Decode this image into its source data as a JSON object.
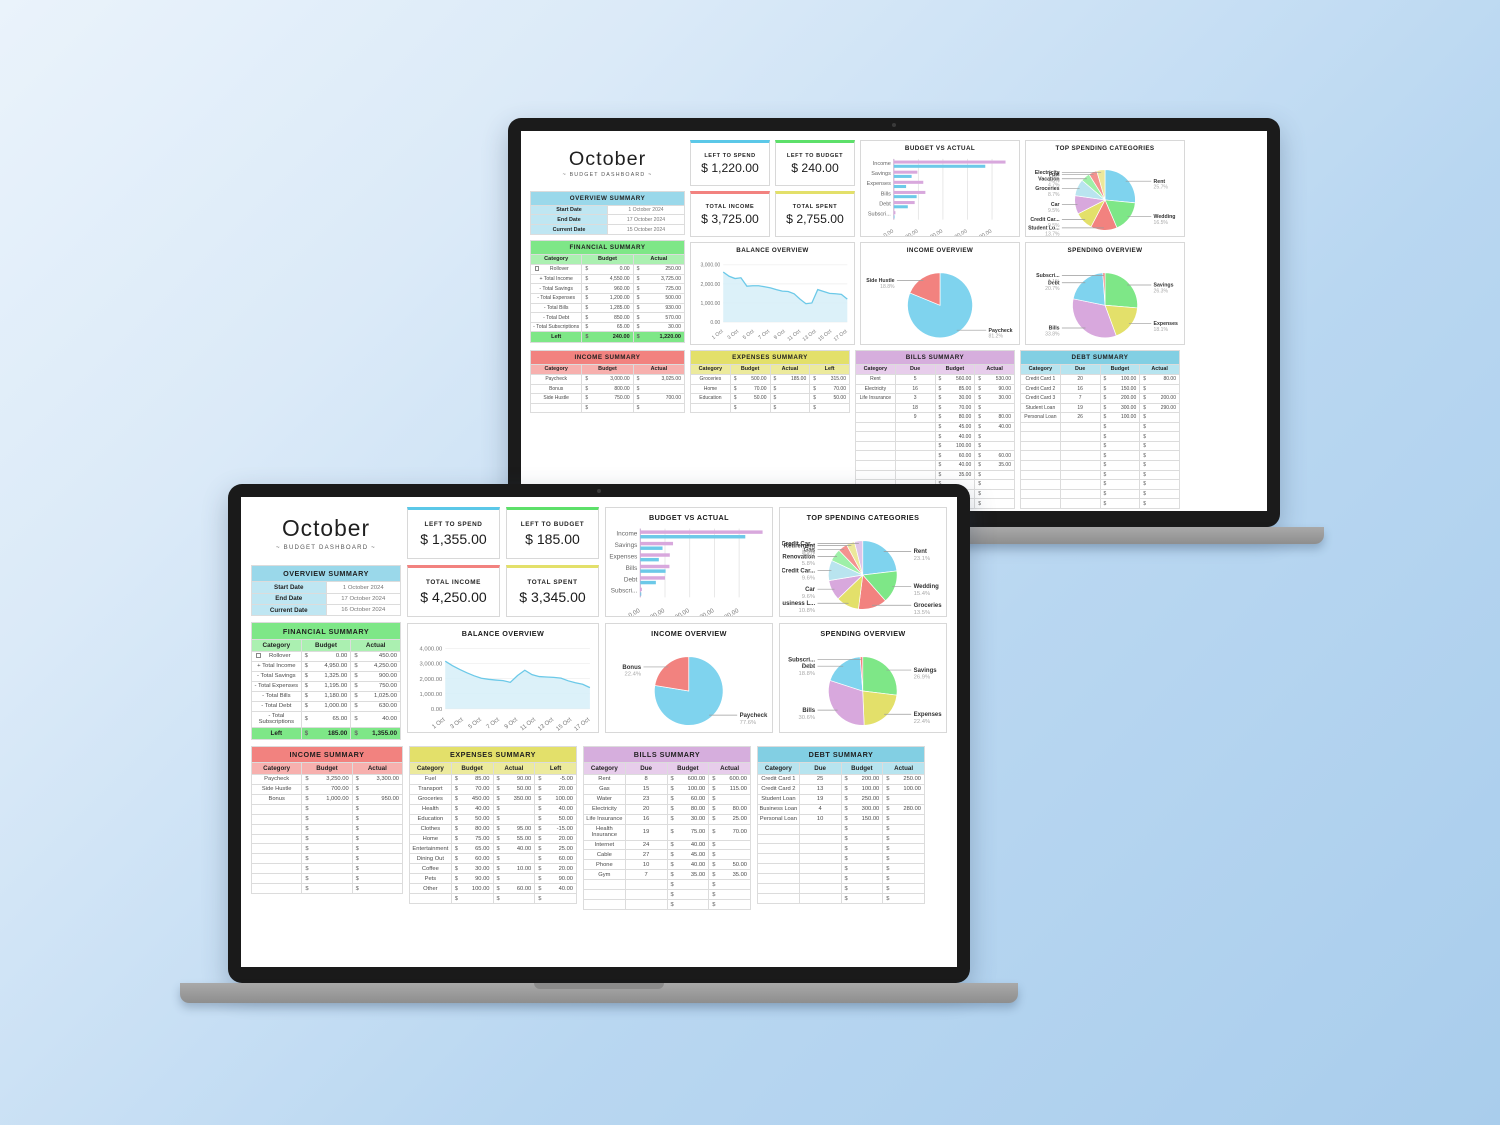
{
  "meta": {
    "background_gradient_from": "#eaf3fb",
    "background_gradient_to": "#a9cdec",
    "laptop_frame_color": "#1a1a1a",
    "laptop_base_color": "#9a9a9a"
  },
  "front": {
    "title": {
      "month": "October",
      "subtitle": "~ BUDGET DASHBOARD ~"
    },
    "kpis": [
      {
        "label": "LEFT TO SPEND",
        "value": "$ 1,355.00",
        "accent": "#5bc8e8"
      },
      {
        "label": "LEFT TO BUDGET",
        "value": "$ 185.00",
        "accent": "#5de06a"
      },
      {
        "label": "TOTAL INCOME",
        "value": "$ 4,250.00",
        "accent": "#f2827f"
      },
      {
        "label": "TOTAL SPENT",
        "value": "$ 3,345.00",
        "accent": "#e3e06a"
      }
    ],
    "overview_summary": {
      "title": "OVERVIEW SUMMARY",
      "rows": [
        {
          "label": "Start Date",
          "value": "1 October 2024"
        },
        {
          "label": "End Date",
          "value": "17 October 2024"
        },
        {
          "label": "Current Date",
          "value": "16 October 2024"
        }
      ]
    },
    "financial_summary": {
      "title": "FINANCIAL SUMMARY",
      "headers": [
        "Category",
        "Budget",
        "Actual"
      ],
      "rows": [
        {
          "label": "Rollover",
          "budget": "0.00",
          "actual": "450.00",
          "checkbox": true
        },
        {
          "label": "+ Total Income",
          "budget": "4,950.00",
          "actual": "4,250.00"
        },
        {
          "label": "- Total Savings",
          "budget": "1,325.00",
          "actual": "900.00"
        },
        {
          "label": "- Total Expenses",
          "budget": "1,195.00",
          "actual": "750.00"
        },
        {
          "label": "- Total Bills",
          "budget": "1,180.00",
          "actual": "1,025.00"
        },
        {
          "label": "- Total Debt",
          "budget": "1,000.00",
          "actual": "630.00"
        },
        {
          "label": "- Total Subscriptions",
          "budget": "65.00",
          "actual": "40.00"
        }
      ],
      "total": {
        "label": "Left",
        "budget": "185.00",
        "actual": "1,355.00"
      }
    },
    "income_summary": {
      "title": "INCOME SUMMARY",
      "headers": [
        "Category",
        "Budget",
        "Actual"
      ],
      "rows": [
        {
          "c": "Paycheck",
          "b": "3,250.00",
          "a": "3,300.00"
        },
        {
          "c": "Side Hustle",
          "b": "700.00",
          "a": ""
        },
        {
          "c": "Bonus",
          "b": "1,000.00",
          "a": "950.00"
        }
      ],
      "blank_rows": 9
    },
    "expenses_summary": {
      "title": "EXPENSES SUMMARY",
      "headers": [
        "Category",
        "Budget",
        "Actual",
        "Left"
      ],
      "rows": [
        {
          "c": "Fuel",
          "b": "85.00",
          "a": "90.00",
          "l": "-5.00"
        },
        {
          "c": "Transport",
          "b": "70.00",
          "a": "50.00",
          "l": "20.00"
        },
        {
          "c": "Groceries",
          "b": "450.00",
          "a": "350.00",
          "l": "100.00"
        },
        {
          "c": "Health",
          "b": "40.00",
          "a": "",
          "l": "40.00"
        },
        {
          "c": "Education",
          "b": "50.00",
          "a": "",
          "l": "50.00"
        },
        {
          "c": "Clothes",
          "b": "80.00",
          "a": "95.00",
          "l": "-15.00"
        },
        {
          "c": "Home",
          "b": "75.00",
          "a": "55.00",
          "l": "20.00"
        },
        {
          "c": "Entertainment",
          "b": "65.00",
          "a": "40.00",
          "l": "25.00"
        },
        {
          "c": "Dining Out",
          "b": "60.00",
          "a": "",
          "l": "60.00"
        },
        {
          "c": "Coffee",
          "b": "30.00",
          "a": "10.00",
          "l": "20.00"
        },
        {
          "c": "Pets",
          "b": "90.00",
          "a": "",
          "l": "90.00"
        },
        {
          "c": "Other",
          "b": "100.00",
          "a": "60.00",
          "l": "40.00"
        }
      ],
      "blank_rows": 1
    },
    "bills_summary": {
      "title": "BILLS SUMMARY",
      "headers": [
        "Category",
        "Due",
        "Budget",
        "Actual"
      ],
      "rows": [
        {
          "c": "Rent",
          "d": "8",
          "b": "600.00",
          "a": "600.00"
        },
        {
          "c": "Gas",
          "d": "15",
          "b": "100.00",
          "a": "115.00"
        },
        {
          "c": "Water",
          "d": "23",
          "b": "60.00",
          "a": ""
        },
        {
          "c": "Electricity",
          "d": "20",
          "b": "80.00",
          "a": "80.00"
        },
        {
          "c": "Life Insurance",
          "d": "16",
          "b": "30.00",
          "a": "25.00"
        },
        {
          "c": "Health Insurance",
          "d": "19",
          "b": "75.00",
          "a": "70.00"
        },
        {
          "c": "Internet",
          "d": "24",
          "b": "40.00",
          "a": ""
        },
        {
          "c": "Cable",
          "d": "27",
          "b": "45.00",
          "a": ""
        },
        {
          "c": "Phone",
          "d": "10",
          "b": "40.00",
          "a": "50.00"
        },
        {
          "c": "Gym",
          "d": "7",
          "b": "35.00",
          "a": "35.00"
        }
      ],
      "blank_rows": 3
    },
    "debt_summary": {
      "title": "DEBT SUMMARY",
      "headers": [
        "Category",
        "Due",
        "Budget",
        "Actual"
      ],
      "rows": [
        {
          "c": "Credit Card 1",
          "d": "25",
          "b": "200.00",
          "a": "250.00"
        },
        {
          "c": "Credit Card 2",
          "d": "13",
          "b": "100.00",
          "a": "100.00"
        },
        {
          "c": "Student Loan",
          "d": "19",
          "b": "250.00",
          "a": ""
        },
        {
          "c": "Business Loan",
          "d": "4",
          "b": "300.00",
          "a": "280.00"
        },
        {
          "c": "Personal Loan",
          "d": "10",
          "b": "150.00",
          "a": ""
        }
      ],
      "blank_rows": 8
    },
    "chart_data": [
      {
        "type": "bar",
        "title": "BUDGET VS ACTUAL",
        "orientation": "horizontal",
        "categories": [
          "Income",
          "Savings",
          "Expenses",
          "Bills",
          "Debt",
          "Subscri..."
        ],
        "series": [
          {
            "name": "Budget",
            "color": "#d8a8dd",
            "values": [
              4950,
              1325,
              1195,
              1180,
              1000,
              65
            ]
          },
          {
            "name": "Actual",
            "color": "#6cc9e8",
            "values": [
              4250,
              900,
              750,
              1025,
              630,
              40
            ]
          }
        ],
        "xlim": [
          0,
          5000
        ],
        "xticks": [
          "0.00",
          "1,000.00",
          "2,000.00",
          "3,000.00",
          "4,000.00"
        ],
        "grid": true
      },
      {
        "type": "pie",
        "title": "TOP SPENDING CATEGORIES",
        "labels": [
          "Rent",
          "Wedding",
          "Groceries",
          "Business L...",
          "Car",
          "Credit Car...",
          "Renovation",
          "Gas",
          "Retirement",
          "Credit Car..."
        ],
        "percents": [
          23.1,
          15.4,
          13.5,
          10.8,
          9.6,
          9.6,
          5.8,
          4.4,
          3.9,
          3.9
        ],
        "colors": [
          "#7fd3ee",
          "#7ee787",
          "#f2827f",
          "#e3e06a",
          "#d8a8dd",
          "#b9e4ef",
          "#9ef0a8",
          "#f4928f",
          "#ece89a",
          "#e0c4e8"
        ]
      },
      {
        "type": "area",
        "title": "BALANCE OVERVIEW",
        "line_color": "#6cc9e8",
        "fill_color": "#d6eef8",
        "ylim": [
          0,
          4000
        ],
        "yticks": [
          "0.00",
          "1,000.00",
          "2,000.00",
          "3,000.00",
          "4,000.00"
        ],
        "xticks": [
          "1 Oct",
          "3 Oct",
          "5 Oct",
          "7 Oct",
          "9 Oct",
          "11 Oct",
          "13 Oct",
          "15 Oct",
          "17 Oct"
        ],
        "values": [
          3150,
          2850,
          2600,
          2380,
          2180,
          2020,
          1950,
          1900,
          1860,
          1750,
          2200,
          2550,
          2260,
          2130,
          2100,
          2080,
          2030,
          1850,
          1720,
          1620,
          1400
        ]
      },
      {
        "type": "pie",
        "title": "INCOME OVERVIEW",
        "labels": [
          "Paycheck",
          "Bonus"
        ],
        "percents": [
          77.6,
          22.4
        ],
        "colors": [
          "#7fd3ee",
          "#f2827f"
        ]
      },
      {
        "type": "pie",
        "title": "SPENDING OVERVIEW",
        "labels": [
          "Savings",
          "Expenses",
          "Bills",
          "Debt",
          "Subscri..."
        ],
        "percents": [
          26.9,
          22.4,
          30.6,
          18.8,
          1.2
        ],
        "colors": [
          "#7ee787",
          "#e3e06a",
          "#d8a8dd",
          "#7fd3ee",
          "#f2827f"
        ]
      }
    ]
  },
  "back": {
    "title": {
      "month": "October",
      "subtitle": "~ BUDGET DASHBOARD ~"
    },
    "kpis": [
      {
        "label": "LEFT TO SPEND",
        "value": "$ 1,220.00",
        "accent": "#5bc8e8"
      },
      {
        "label": "LEFT TO BUDGET",
        "value": "$ 240.00",
        "accent": "#5de06a"
      },
      {
        "label": "TOTAL INCOME",
        "value": "$ 3,725.00",
        "accent": "#f2827f"
      },
      {
        "label": "TOTAL SPENT",
        "value": "$ 2,755.00",
        "accent": "#e3e06a"
      }
    ],
    "overview_summary": {
      "title": "OVERVIEW SUMMARY",
      "rows": [
        {
          "label": "Start Date",
          "value": "1 October 2024"
        },
        {
          "label": "End Date",
          "value": "17 October 2024"
        },
        {
          "label": "Current Date",
          "value": "15 October 2024"
        }
      ]
    },
    "financial_summary": {
      "title": "FINANCIAL SUMMARY",
      "headers": [
        "Category",
        "Budget",
        "Actual"
      ],
      "rows": [
        {
          "label": "Rollover",
          "budget": "0.00",
          "actual": "250.00",
          "checkbox": true
        },
        {
          "label": "+ Total Income",
          "budget": "4,550.00",
          "actual": "3,725.00"
        },
        {
          "label": "- Total Savings",
          "budget": "960.00",
          "actual": "725.00"
        },
        {
          "label": "- Total Expenses",
          "budget": "1,200.00",
          "actual": "500.00"
        },
        {
          "label": "- Total Bills",
          "budget": "1,285.00",
          "actual": "930.00"
        },
        {
          "label": "- Total Debt",
          "budget": "850.00",
          "actual": "570.00"
        },
        {
          "label": "- Total Subscriptions",
          "budget": "65.00",
          "actual": "30.00"
        }
      ],
      "total": {
        "label": "Left",
        "budget": "240.00",
        "actual": "1,220.00"
      }
    },
    "income_summary": {
      "title": "INCOME SUMMARY",
      "headers": [
        "Category",
        "Budget",
        "Actual"
      ],
      "rows": [
        {
          "c": "Paycheck",
          "b": "3,000.00",
          "a": "3,025.00"
        },
        {
          "c": "Bonus",
          "b": "800.00",
          "a": ""
        },
        {
          "c": "Side Hustle",
          "b": "750.00",
          "a": "700.00"
        }
      ],
      "blank_rows": 1
    },
    "expenses_summary": {
      "title": "EXPENSES SUMMARY",
      "headers": [
        "Category",
        "Budget",
        "Actual",
        "Left"
      ],
      "rows": [
        {
          "c": "Groceries",
          "b": "500.00",
          "a": "185.00",
          "l": "315.00"
        },
        {
          "c": "Home",
          "b": "70.00",
          "a": "",
          "l": "70.00"
        },
        {
          "c": "Education",
          "b": "50.00",
          "a": "",
          "l": "50.00"
        }
      ],
      "blank_rows": 1
    },
    "bills_summary": {
      "title": "BILLS SUMMARY",
      "headers": [
        "Category",
        "Due",
        "Budget",
        "Actual"
      ],
      "rows": [
        {
          "c": "Rent",
          "d": "5",
          "b": "560.00",
          "a": "530.00"
        },
        {
          "c": "Electricity",
          "d": "16",
          "b": "85.00",
          "a": "90.00"
        },
        {
          "c": "Life Insurance",
          "d": "3",
          "b": "30.00",
          "a": "30.00"
        },
        {
          "c": "",
          "d": "18",
          "b": "70.00",
          "a": ""
        },
        {
          "c": "",
          "d": "9",
          "b": "80.00",
          "a": "80.00"
        },
        {
          "c": "",
          "d": "",
          "b": "45.00",
          "a": "40.00"
        },
        {
          "c": "",
          "d": "",
          "b": "40.00",
          "a": ""
        },
        {
          "c": "",
          "d": "",
          "b": "100.00",
          "a": ""
        },
        {
          "c": "",
          "d": "",
          "b": "60.00",
          "a": "60.00"
        },
        {
          "c": "",
          "d": "",
          "b": "40.00",
          "a": "35.00"
        },
        {
          "c": "",
          "d": "",
          "b": "35.00",
          "a": ""
        }
      ],
      "blank_rows": 3
    },
    "debt_summary": {
      "title": "DEBT SUMMARY",
      "headers": [
        "Category",
        "Due",
        "Budget",
        "Actual"
      ],
      "rows": [
        {
          "c": "Credit Card 1",
          "d": "20",
          "b": "100.00",
          "a": "80.00"
        },
        {
          "c": "Credit Card 2",
          "d": "16",
          "b": "150.00",
          "a": ""
        },
        {
          "c": "Credit Card 3",
          "d": "7",
          "b": "200.00",
          "a": "200.00"
        },
        {
          "c": "Student Loan",
          "d": "19",
          "b": "300.00",
          "a": "290.00"
        },
        {
          "c": "Personal Loan",
          "d": "26",
          "b": "100.00",
          "a": ""
        }
      ],
      "blank_rows": 9
    },
    "chart_data": [
      {
        "type": "bar",
        "title": "BUDGET VS ACTUAL",
        "orientation": "horizontal",
        "categories": [
          "Income",
          "Savings",
          "Expenses",
          "Bills",
          "Debt",
          "Subscri..."
        ],
        "series": [
          {
            "name": "Budget",
            "color": "#d8a8dd",
            "values": [
              4550,
              960,
              1200,
              1285,
              850,
              65
            ]
          },
          {
            "name": "Actual",
            "color": "#6cc9e8",
            "values": [
              3725,
              725,
              500,
              930,
              570,
              30
            ]
          }
        ],
        "xlim": [
          0,
          4800
        ],
        "xticks": [
          "0.00",
          "1,000.00",
          "2,000.00",
          "3,000.00",
          "4,000.00"
        ],
        "grid": true
      },
      {
        "type": "pie",
        "title": "TOP SPENDING CATEGORIES",
        "labels": [
          "Rent",
          "Wedding",
          "Student Lo...",
          "Credit Car...",
          "Car",
          "Groceries",
          "Vacation",
          "Fuel",
          "Electricity"
        ],
        "percents": [
          25.7,
          16.5,
          13.7,
          9.5,
          9.5,
          8.7,
          4.7,
          4.3,
          4.3
        ],
        "colors": [
          "#7fd3ee",
          "#7ee787",
          "#f2827f",
          "#e3e06a",
          "#d8a8dd",
          "#b9e4ef",
          "#9ef0a8",
          "#f4928f",
          "#ece89a"
        ]
      },
      {
        "type": "area",
        "title": "BALANCE OVERVIEW",
        "line_color": "#6cc9e8",
        "fill_color": "#d6eef8",
        "ylim": [
          0,
          3000
        ],
        "yticks": [
          "0.00",
          "1,000.00",
          "2,000.00",
          "3,000.00"
        ],
        "xticks": [
          "1 Oct",
          "3 Oct",
          "5 Oct",
          "7 Oct",
          "9 Oct",
          "11 Oct",
          "13 Oct",
          "15 Oct",
          "17 Oct"
        ],
        "values": [
          2620,
          2400,
          2280,
          2320,
          1880,
          1900,
          1900,
          1850,
          1790,
          1700,
          1620,
          1600,
          1480,
          1200,
          960,
          1000,
          1700,
          1600,
          1500,
          1480,
          1450,
          1200
        ]
      },
      {
        "type": "pie",
        "title": "INCOME OVERVIEW",
        "labels": [
          "Paycheck",
          "Side Hustle"
        ],
        "percents": [
          81.2,
          18.8
        ],
        "colors": [
          "#7fd3ee",
          "#f2827f"
        ]
      },
      {
        "type": "pie",
        "title": "SPENDING OVERVIEW",
        "labels": [
          "Savings",
          "Expenses",
          "Bills",
          "Debt",
          "Subscri..."
        ],
        "percents": [
          26.3,
          18.1,
          33.8,
          20.7,
          1.1
        ],
        "colors": [
          "#7ee787",
          "#e3e06a",
          "#d8a8dd",
          "#7fd3ee",
          "#f2827f"
        ]
      }
    ]
  }
}
